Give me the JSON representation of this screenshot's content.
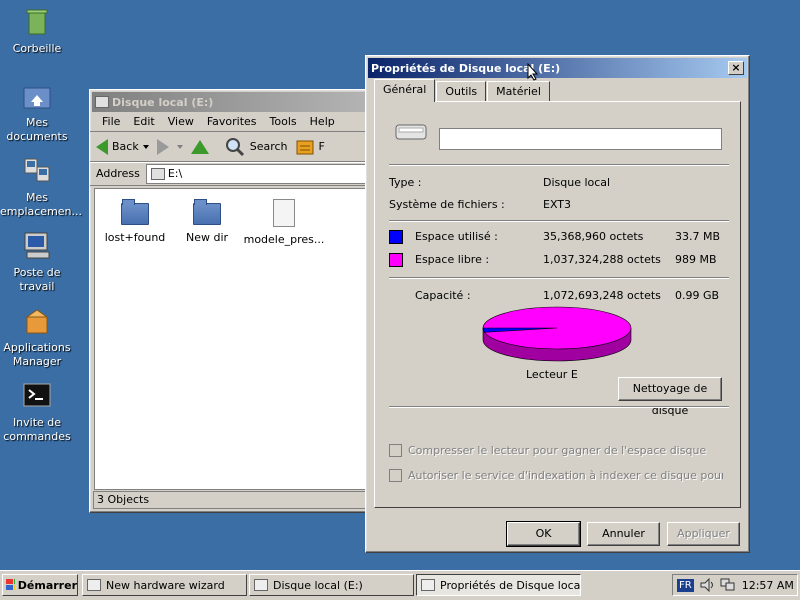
{
  "desktop": {
    "icons": [
      {
        "label": "Corbeille"
      },
      {
        "label": "Mes documents"
      },
      {
        "label": "Mes emplacemen..."
      },
      {
        "label": "Poste de travail"
      },
      {
        "label": "Applications Manager"
      },
      {
        "label": "Invite de commandes"
      }
    ]
  },
  "explorer": {
    "title": "Disque local (E:)",
    "menu": {
      "file": "File",
      "edit": "Edit",
      "view": "View",
      "favorites": "Favorites",
      "tools": "Tools",
      "help": "Help"
    },
    "toolbar": {
      "back": "Back",
      "search": "Search",
      "folders_partial": "F"
    },
    "address_label": "Address",
    "address_value": "E:\\",
    "files": [
      {
        "name": "lost+found",
        "icon": "folder-icon"
      },
      {
        "name": "New dir",
        "icon": "folder-icon"
      },
      {
        "name": "modele_pres...",
        "icon": "document-icon"
      }
    ],
    "status": "3 Objects"
  },
  "dialog": {
    "title": "Propriétés de Disque local (E:)",
    "close": "×",
    "tabs": [
      "Général",
      "Outils",
      "Matériel"
    ],
    "name_value": "",
    "type_label": "Type :",
    "type_value": "Disque local",
    "fs_label": "Système de fichiers :",
    "fs_value": "EXT3",
    "used_label": "Espace utilisé :",
    "used_bytes": "35,368,960 octets",
    "used_human": "33.7 MB",
    "free_label": "Espace libre :",
    "free_bytes": "1,037,324,288 octets",
    "free_human": "989 MB",
    "cap_label": "Capacité :",
    "cap_bytes": "1,072,693,248 octets",
    "cap_human": "0.99 GB",
    "drive_label": "Lecteur E",
    "cleanup": "Nettoyage de disque",
    "compress": "Compresser le lecteur pour gagner de l'espace disque",
    "index": "Autoriser le service d'indexation à indexer ce disque pour une rech",
    "ok": "OK",
    "cancel": "Annuler",
    "apply": "Appliquer",
    "used_fraction": 0.033,
    "colors": {
      "used": "#0000ff",
      "free": "#ff00ff"
    }
  },
  "taskbar": {
    "start": "Démarrer",
    "tasks": [
      "New hardware wizard",
      "Disque local (E:)",
      "Propriétés de Disque local ..."
    ],
    "lang": "FR",
    "clock": "12:57 AM"
  }
}
